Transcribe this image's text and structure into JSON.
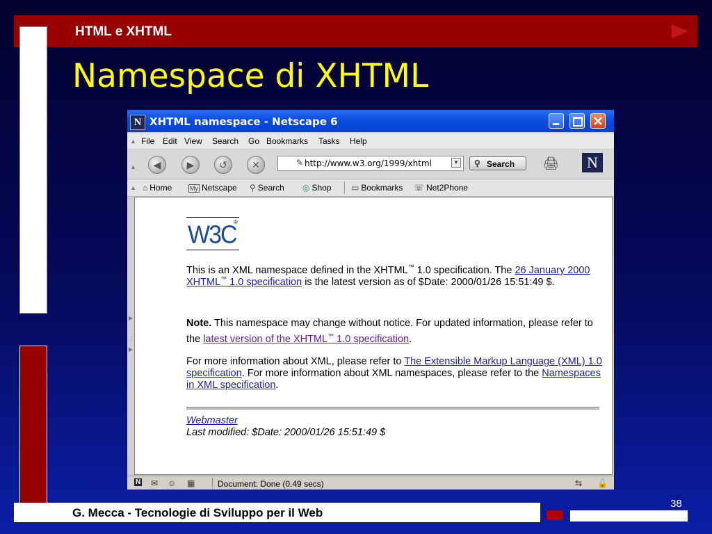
{
  "slide": {
    "header": "HTML e XHTML",
    "title": "Namespace di XHTML",
    "footer": "G. Mecca - Tecnologie di Sviluppo per il Web",
    "page_number": "38",
    "colors": {
      "header_bar": "#990000",
      "title": "#ffff00",
      "background": "#050a5c"
    }
  },
  "browser": {
    "window_title": "XHTML namespace - Netscape 6",
    "app_icon": "N",
    "menu": [
      "File",
      "Edit",
      "View",
      "Search",
      "Go",
      "Bookmarks",
      "Tasks",
      "Help"
    ],
    "nav_buttons": [
      "back-icon",
      "forward-icon",
      "reload-icon",
      "stop-icon"
    ],
    "url": "http://www.w3.org/1999/xhtml",
    "search_label": "Search",
    "throbber": "N",
    "personal_toolbar": [
      {
        "label": "Home",
        "icon": "home-icon"
      },
      {
        "label": "Netscape",
        "icon": "my-netscape-icon",
        "badge": "My"
      },
      {
        "label": "Search",
        "icon": "search-icon"
      },
      {
        "label": "Shop",
        "icon": "shop-icon"
      },
      {
        "label": "Bookmarks",
        "icon": "bookmarks-icon"
      },
      {
        "label": "Net2Phone",
        "icon": "net2phone-icon"
      }
    ],
    "status": "Document: Done (0.49 secs)"
  },
  "page": {
    "logo": "W3C",
    "logo_reg": "®",
    "tm": "™",
    "p1": {
      "t1": "This is an XML namespace defined in the XHTML",
      "t2": " 1.0 specification. The ",
      "link1a": "26 January 2000 XHTML",
      "link1b": " 1.0 specification",
      "t3": " is the latest version as of $Date: 2000/01/26 15:51:49 $."
    },
    "p2": {
      "bold": "Note.",
      "t1": " This namespace may change without notice. For updated information, please refer to the ",
      "link_a": "latest version of the XHTML",
      "link_b": " 1.0 specification",
      "t2": "."
    },
    "p3": {
      "t1": "For more information about XML, please refer to ",
      "link1": "The Extensible Markup Language (XML) 1.0 specification",
      "t2": ". For more information about XML namespaces, please refer to the ",
      "link2": "Namespaces in XML specification",
      "t3": "."
    },
    "footer_link": "Webmaster",
    "last_modified": "Last modified: $Date: 2000/01/26 15:51:49 $"
  }
}
